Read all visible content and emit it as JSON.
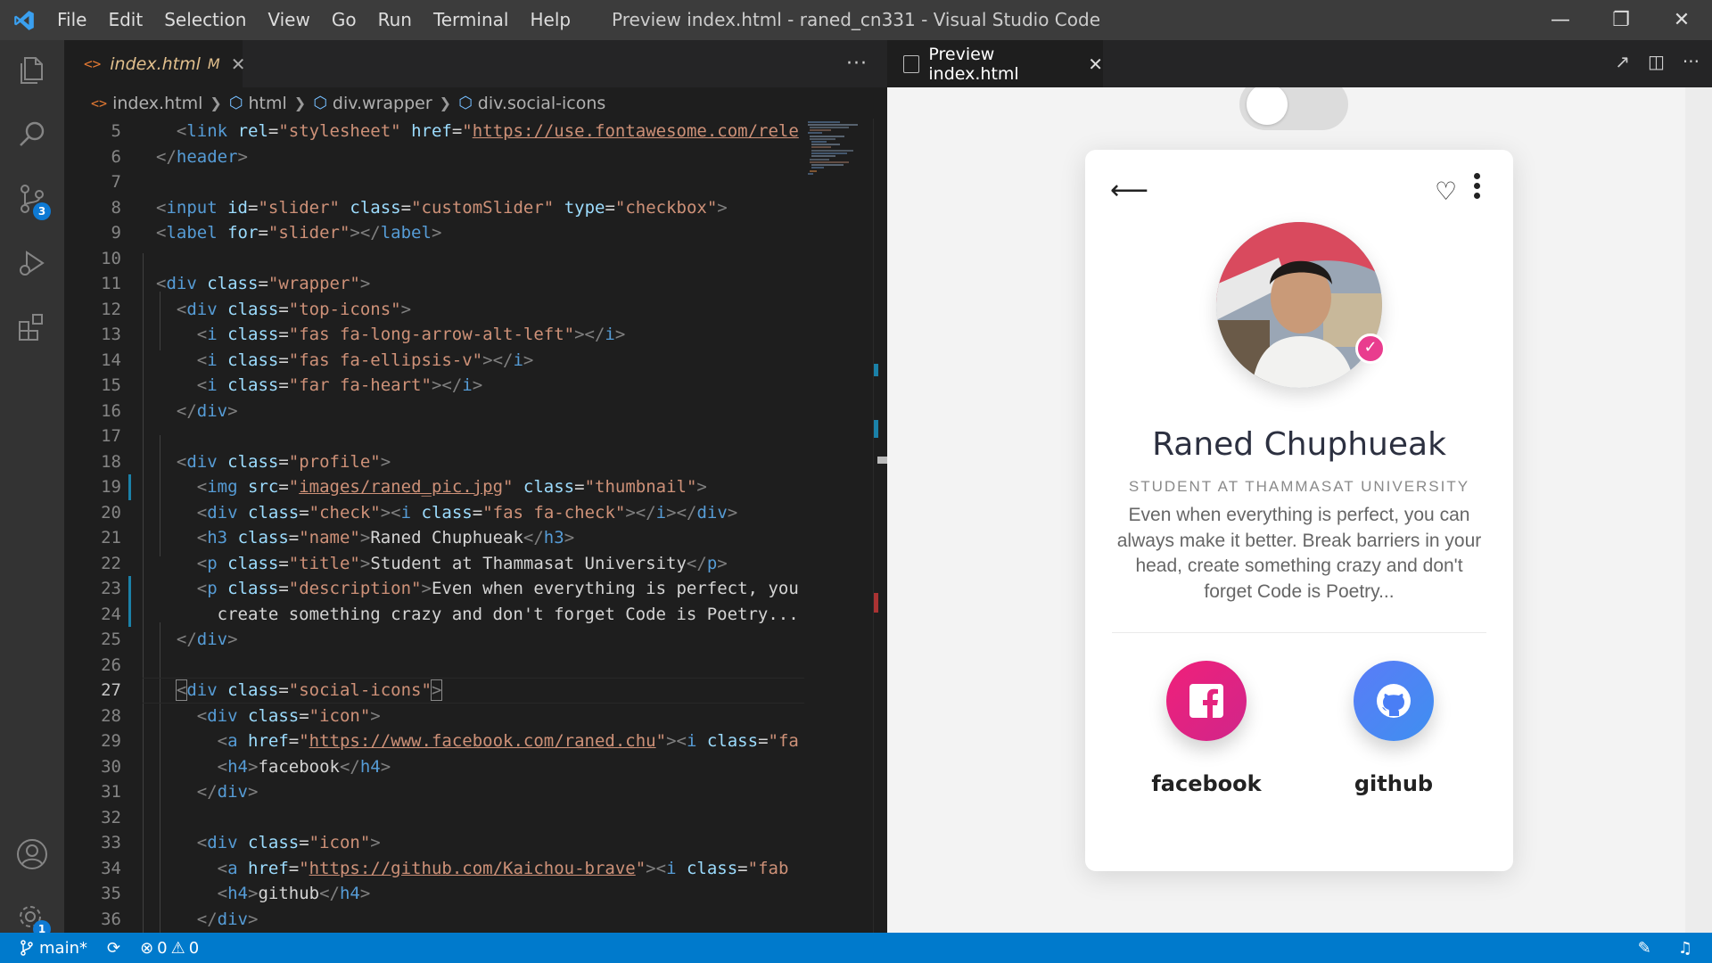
{
  "window": {
    "title": "Preview index.html - raned_cn331 - Visual Studio Code",
    "menu": [
      "File",
      "Edit",
      "Selection",
      "View",
      "Go",
      "Run",
      "Terminal",
      "Help"
    ]
  },
  "activity_bar": {
    "source_control_badge": "3",
    "settings_badge": "1"
  },
  "editor": {
    "tab": {
      "name": "index.html",
      "modified": "M"
    },
    "breadcrumbs": [
      "index.html",
      "html",
      "div.wrapper",
      "div.social-icons"
    ],
    "lines": [
      {
        "n": "5",
        "html": "  <span class=\"pn\">&lt;</span><span class=\"tg\">link</span> <span class=\"at\">rel</span>=<span class=\"st\">\"stylesheet\"</span> <span class=\"at\">href</span>=<span class=\"st\">\"<span class=\"ul\">https://use.fontawesome.com/rele</span></span>"
      },
      {
        "n": "6",
        "html": "<span class=\"pn\">&lt;/</span><span class=\"tg\">header</span><span class=\"pn\">&gt;</span>"
      },
      {
        "n": "7",
        "html": ""
      },
      {
        "n": "8",
        "html": "<span class=\"pn\">&lt;</span><span class=\"tg\">input</span> <span class=\"at\">id</span>=<span class=\"st\">\"slider\"</span> <span class=\"at\">class</span>=<span class=\"st\">\"customSlider\"</span> <span class=\"at\">type</span>=<span class=\"st\">\"checkbox\"</span><span class=\"pn\">&gt;</span>"
      },
      {
        "n": "9",
        "html": "<span class=\"pn\">&lt;</span><span class=\"tg\">label</span> <span class=\"at\">for</span>=<span class=\"st\">\"slider\"</span><span class=\"pn\">&gt;&lt;/</span><span class=\"tg\">label</span><span class=\"pn\">&gt;</span>"
      },
      {
        "n": "10",
        "html": ""
      },
      {
        "n": "11",
        "html": "<span class=\"pn\">&lt;</span><span class=\"tg\">div</span> <span class=\"at\">class</span>=<span class=\"st\">\"wrapper\"</span><span class=\"pn\">&gt;</span>"
      },
      {
        "n": "12",
        "html": "  <span class=\"pn\">&lt;</span><span class=\"tg\">div</span> <span class=\"at\">class</span>=<span class=\"st\">\"top-icons\"</span><span class=\"pn\">&gt;</span>"
      },
      {
        "n": "13",
        "html": "    <span class=\"pn\">&lt;</span><span class=\"tg\">i</span> <span class=\"at\">class</span>=<span class=\"st\">\"fas fa-long-arrow-alt-left\"</span><span class=\"pn\">&gt;&lt;/</span><span class=\"tg\">i</span><span class=\"pn\">&gt;</span>"
      },
      {
        "n": "14",
        "html": "    <span class=\"pn\">&lt;</span><span class=\"tg\">i</span> <span class=\"at\">class</span>=<span class=\"st\">\"fas fa-ellipsis-v\"</span><span class=\"pn\">&gt;&lt;/</span><span class=\"tg\">i</span><span class=\"pn\">&gt;</span>"
      },
      {
        "n": "15",
        "html": "    <span class=\"pn\">&lt;</span><span class=\"tg\">i</span> <span class=\"at\">class</span>=<span class=\"st\">\"far fa-heart\"</span><span class=\"pn\">&gt;&lt;/</span><span class=\"tg\">i</span><span class=\"pn\">&gt;</span>"
      },
      {
        "n": "16",
        "html": "  <span class=\"pn\">&lt;/</span><span class=\"tg\">div</span><span class=\"pn\">&gt;</span>"
      },
      {
        "n": "17",
        "html": ""
      },
      {
        "n": "18",
        "html": "  <span class=\"pn\">&lt;</span><span class=\"tg\">div</span> <span class=\"at\">class</span>=<span class=\"st\">\"profile\"</span><span class=\"pn\">&gt;</span>"
      },
      {
        "n": "19",
        "html": "    <span class=\"pn\">&lt;</span><span class=\"tg\">img</span> <span class=\"at\">src</span>=<span class=\"st\">\"<span class=\"ul\">images/raned_pic.jpg</span>\"</span> <span class=\"at\">class</span>=<span class=\"st\">\"thumbnail\"</span><span class=\"pn\">&gt;</span>"
      },
      {
        "n": "20",
        "html": "    <span class=\"pn\">&lt;</span><span class=\"tg\">div</span> <span class=\"at\">class</span>=<span class=\"st\">\"check\"</span><span class=\"pn\">&gt;&lt;</span><span class=\"tg\">i</span> <span class=\"at\">class</span>=<span class=\"st\">\"fas fa-check\"</span><span class=\"pn\">&gt;&lt;/</span><span class=\"tg\">i</span><span class=\"pn\">&gt;&lt;/</span><span class=\"tg\">div</span><span class=\"pn\">&gt;</span>"
      },
      {
        "n": "21",
        "html": "    <span class=\"pn\">&lt;</span><span class=\"tg\">h3</span> <span class=\"at\">class</span>=<span class=\"st\">\"name\"</span><span class=\"pn\">&gt;</span>Raned Chuphueak<span class=\"pn\">&lt;/</span><span class=\"tg\">h3</span><span class=\"pn\">&gt;</span>"
      },
      {
        "n": "22",
        "html": "    <span class=\"pn\">&lt;</span><span class=\"tg\">p</span> <span class=\"at\">class</span>=<span class=\"st\">\"title\"</span><span class=\"pn\">&gt;</span>Student at Thammasat University<span class=\"pn\">&lt;/</span><span class=\"tg\">p</span><span class=\"pn\">&gt;</span>"
      },
      {
        "n": "23",
        "html": "    <span class=\"pn\">&lt;</span><span class=\"tg\">p</span> <span class=\"at\">class</span>=<span class=\"st\">\"description\"</span><span class=\"pn\">&gt;</span>Even when everything is perfect, you"
      },
      {
        "n": "24",
        "html": "      create something crazy and don't forget Code is Poetry..."
      },
      {
        "n": "25",
        "html": "  <span class=\"pn\">&lt;/</span><span class=\"tg\">div</span><span class=\"pn\">&gt;</span>"
      },
      {
        "n": "26",
        "html": ""
      },
      {
        "n": "27",
        "html": "  <span class=\"pn\" style=\"outline:1px solid #888\">&lt;</span><span class=\"tg\">div</span> <span class=\"at\">class</span>=<span class=\"st\">\"social-icons\"</span><span class=\"pn\" style=\"outline:1px solid #888\">&gt;</span>"
      },
      {
        "n": "28",
        "html": "    <span class=\"pn\">&lt;</span><span class=\"tg\">div</span> <span class=\"at\">class</span>=<span class=\"st\">\"icon\"</span><span class=\"pn\">&gt;</span>"
      },
      {
        "n": "29",
        "html": "      <span class=\"pn\">&lt;</span><span class=\"tg\">a</span> <span class=\"at\">href</span>=<span class=\"st\">\"<span class=\"ul\">https://www.facebook.com/raned.chu</span>\"</span><span class=\"pn\">&gt;&lt;</span><span class=\"tg\">i</span> <span class=\"at\">class</span>=<span class=\"st\">\"fa</span>"
      },
      {
        "n": "30",
        "html": "      <span class=\"pn\">&lt;</span><span class=\"tg\">h4</span><span class=\"pn\">&gt;</span>facebook<span class=\"pn\">&lt;/</span><span class=\"tg\">h4</span><span class=\"pn\">&gt;</span>"
      },
      {
        "n": "31",
        "html": "    <span class=\"pn\">&lt;/</span><span class=\"tg\">div</span><span class=\"pn\">&gt;</span>"
      },
      {
        "n": "32",
        "html": ""
      },
      {
        "n": "33",
        "html": "    <span class=\"pn\">&lt;</span><span class=\"tg\">div</span> <span class=\"at\">class</span>=<span class=\"st\">\"icon\"</span><span class=\"pn\">&gt;</span>"
      },
      {
        "n": "34",
        "html": "      <span class=\"pn\">&lt;</span><span class=\"tg\">a</span> <span class=\"at\">href</span>=<span class=\"st\">\"<span class=\"ul\">https://github.com/Kaichou-brave</span>\"</span><span class=\"pn\">&gt;&lt;</span><span class=\"tg\">i</span> <span class=\"at\">class</span>=<span class=\"st\">\"fab</span>"
      },
      {
        "n": "35",
        "html": "      <span class=\"pn\">&lt;</span><span class=\"tg\">h4</span><span class=\"pn\">&gt;</span>github<span class=\"pn\">&lt;/</span><span class=\"tg\">h4</span><span class=\"pn\">&gt;</span>"
      },
      {
        "n": "36",
        "html": "    <span class=\"pn\">&lt;/</span><span class=\"tg\">div</span><span class=\"pn\">&gt;</span>"
      }
    ],
    "current_line": "27",
    "modified_lines": [
      "19",
      "23",
      "24"
    ]
  },
  "preview": {
    "tab_title": "Preview index.html",
    "profile": {
      "name": "Raned Chuphueak",
      "title": "STUDENT AT THAMMASAT UNIVERSITY",
      "description": "Even when everything is perfect, you can always make it better. Break barriers in your head, create something crazy and don't forget Code is Poetry..."
    },
    "social": [
      {
        "label": "facebook",
        "icon": "facebook-icon",
        "color": "#e91e63"
      },
      {
        "label": "github",
        "icon": "github-icon",
        "color": "#4f6ef7"
      }
    ]
  },
  "statusbar": {
    "branch": "main*",
    "errors": "0",
    "warnings": "0"
  },
  "colors": {
    "accent": "#007acc",
    "tag": "#569cd6",
    "attribute": "#9cdcfe",
    "string": "#ce9178"
  }
}
